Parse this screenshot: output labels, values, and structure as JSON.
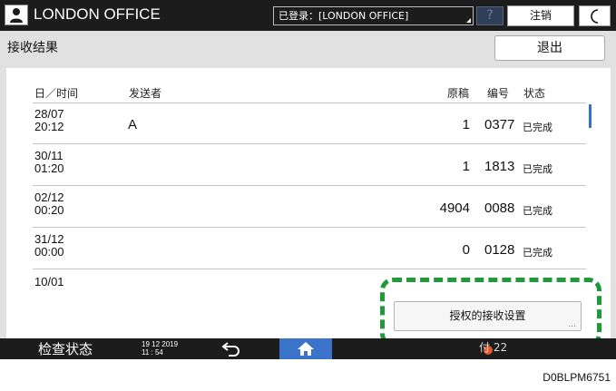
{
  "topbar": {
    "office_name": "LONDON OFFICE",
    "login_status": "已登录：[LONDON OFFICE]",
    "help_label": "?",
    "logout_label": "注销"
  },
  "header": {
    "title": "接收结果",
    "exit_label": "退出"
  },
  "list": {
    "columns": {
      "date": "日／时间",
      "sender": "发送者",
      "originals": "原稿",
      "number": "编号",
      "status": "状态"
    },
    "rows": [
      {
        "date": "28/07",
        "time": "20:12",
        "sender": "A",
        "originals": "1",
        "number": "0377",
        "status": "已完成"
      },
      {
        "date": "30/11",
        "time": "01:20",
        "sender": "",
        "originals": "1",
        "number": "1813",
        "status": "已完成"
      },
      {
        "date": "02/12",
        "time": "00:20",
        "sender": "",
        "originals": "4904",
        "number": "0088",
        "status": "已完成"
      },
      {
        "date": "31/12",
        "time": "00:00",
        "sender": "",
        "originals": "0",
        "number": "0128",
        "status": "已完成"
      },
      {
        "date": "10/01",
        "time": "",
        "sender": "",
        "originals": "",
        "number": "",
        "status": ""
      }
    ]
  },
  "auth_settings": {
    "label": "授权的接收设置",
    "dots": "..."
  },
  "bottombar": {
    "check_status": "检查状态",
    "date": "19 12 2019",
    "time": "11 : 54",
    "right_fragment": "付 22"
  },
  "footer_code": "D0BLPM6751",
  "colors": {
    "highlight": "#1e9a3a",
    "home_button": "#3a73c9",
    "scroll_indicator": "#2f6fd6"
  }
}
